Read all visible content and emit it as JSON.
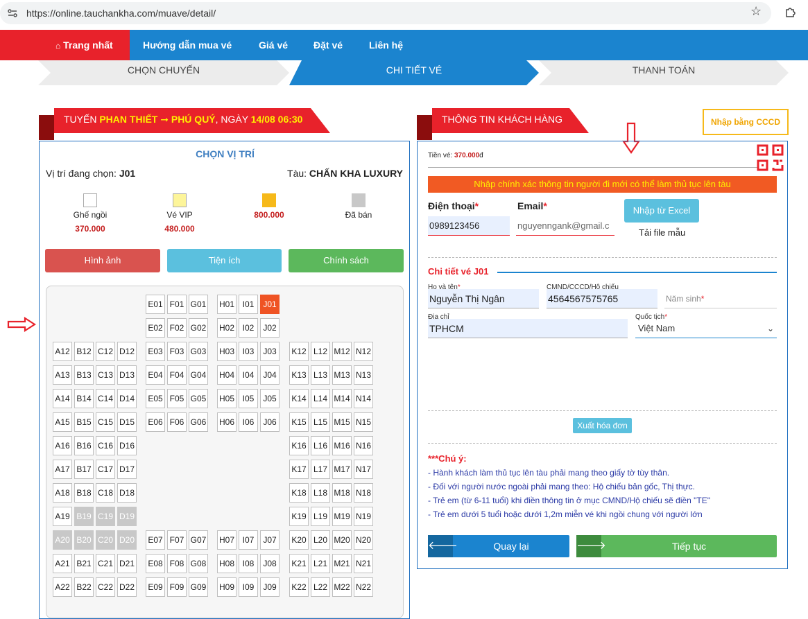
{
  "browser": {
    "url": "https://online.tauchankha.com/muave/detail/"
  },
  "nav": {
    "home": "Trang nhất",
    "items": [
      "Hướng dẫn mua vé",
      "Giá vé",
      "Đặt vé",
      "Liên hệ"
    ]
  },
  "steps": [
    "CHỌN CHUYẾN",
    "CHI TIẾT VÉ",
    "THANH TOÁN"
  ],
  "route": {
    "prefix": "TUYẾN ",
    "from_to": "PHAN THIẾT ➞ PHÚ QUÝ",
    "mid": ", NGÀY ",
    "datetime": "14/08 06:30"
  },
  "seat_panel": {
    "title": "CHỌN VỊ TRÍ",
    "selected_label": "Vị trí đang chọn: ",
    "selected_value": "J01",
    "ship_label": "Tàu: ",
    "ship_value": "CHẤN KHA LUXURY",
    "legend": [
      {
        "label": "Ghế ngồi",
        "price": "370.000",
        "color": "#ffffff"
      },
      {
        "label": "Vé VIP",
        "price": "480.000",
        "color": "#fdf59a"
      },
      {
        "label": "",
        "price": "800.000",
        "color": "#f6b91a"
      },
      {
        "label": "Đã bán",
        "price": "",
        "color": "#c8c8c8"
      }
    ],
    "buttons": {
      "images": "Hình ảnh",
      "amenities": "Tiện ích",
      "policy": "Chính sách"
    },
    "seats": [
      [
        "E01",
        "F01",
        "G01",
        "H01",
        "I01",
        "J01"
      ],
      [
        "E02",
        "F02",
        "G02",
        "H02",
        "I02",
        "J02"
      ],
      [
        "A12",
        "B12",
        "C12",
        "D12",
        "E03",
        "F03",
        "G03",
        "H03",
        "I03",
        "J03",
        "K12",
        "L12",
        "M12",
        "N12"
      ],
      [
        "A13",
        "B13",
        "C13",
        "D13",
        "E04",
        "F04",
        "G04",
        "H04",
        "I04",
        "J04",
        "K13",
        "L13",
        "M13",
        "N13"
      ],
      [
        "A14",
        "B14",
        "C14",
        "D14",
        "E05",
        "F05",
        "G05",
        "H05",
        "I05",
        "J05",
        "K14",
        "L14",
        "M14",
        "N14"
      ],
      [
        "A15",
        "B15",
        "C15",
        "D15",
        "E06",
        "F06",
        "G06",
        "H06",
        "I06",
        "J06",
        "K15",
        "L15",
        "M15",
        "N15"
      ],
      [
        "A16",
        "B16",
        "C16",
        "D16",
        "K16",
        "L16",
        "M16",
        "N16"
      ],
      [
        "A17",
        "B17",
        "C17",
        "D17",
        "K17",
        "L17",
        "M17",
        "N17"
      ],
      [
        "A18",
        "B18",
        "C18",
        "D18",
        "K18",
        "L18",
        "M18",
        "N18"
      ],
      [
        "A19",
        "B19",
        "C19",
        "D19",
        "K19",
        "L19",
        "M19",
        "N19"
      ],
      [
        "A20",
        "B20",
        "C20",
        "D20",
        "E07",
        "F07",
        "G07",
        "H07",
        "I07",
        "J07",
        "K20",
        "L20",
        "M20",
        "N20"
      ],
      [
        "A21",
        "B21",
        "C21",
        "D21",
        "E08",
        "F08",
        "G08",
        "H08",
        "I08",
        "J08",
        "K21",
        "L21",
        "M21",
        "N21"
      ],
      [
        "A22",
        "B22",
        "C22",
        "D22",
        "E09",
        "F09",
        "G09",
        "H09",
        "I09",
        "J09",
        "K22",
        "L22",
        "M22",
        "N22"
      ]
    ],
    "sold": [
      "B19",
      "C19",
      "D19",
      "A20",
      "B20",
      "C20",
      "D20"
    ],
    "selected": "J01"
  },
  "customer": {
    "header": "THÔNG TIN KHÁCH HÀNG",
    "cccd_button": "Nhập bằng CCCD",
    "ticket_price_label": "Tiền vé: ",
    "ticket_price_value": "370.000",
    "ticket_price_unit": "đ",
    "warning": "Nhập chính xác thông tin người đi mới có thể làm thủ tục lên tàu",
    "phone_label": "Điện thoại",
    "phone_value": "0989123456",
    "email_label": "Email",
    "email_value": "nguyenngank@gmail.c",
    "excel_button": "Nhập từ Excel",
    "template_link": "Tải file mẫu",
    "detail_title": "Chi tiết vé J01",
    "name_label": "Họ và tên",
    "name_value": "Nguyễn Thị Ngân",
    "id_label": "CMND/CCCD/Hộ chiếu",
    "id_value": "4564567575765",
    "birth_placeholder": "Năm sinh",
    "address_label": "Địa chỉ",
    "address_value": "TPHCM",
    "nationality_label": "Quốc tịch",
    "nationality_value": "Việt Nam",
    "invoice_button": "Xuất hóa đơn",
    "notes_title": "***Chú ý:",
    "notes": [
      "- Hành khách làm thủ tục lên tàu phải mang theo giấy tờ tùy thân.",
      "- Đối với người nước ngoài phải mang theo: Hộ chiếu bản gốc, Thị thực.",
      "- Trẻ em (từ 6-11 tuổi) khi điền thông tin ở mục CMND/Hộ chiếu sẽ điền \"TE\"",
      "- Trẻ em dưới 5 tuổi hoặc dưới 1,2m miễn vé khi ngồi chung với người lớn"
    ],
    "back_button": "Quay lại",
    "next_button": "Tiếp tục",
    "required_mark": "*"
  }
}
